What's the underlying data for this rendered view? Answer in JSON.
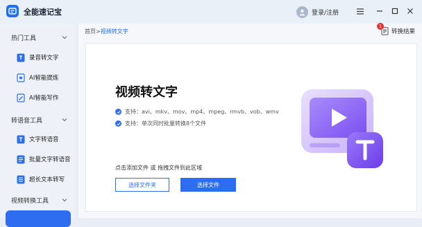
{
  "app": {
    "title": "全能速记宝"
  },
  "user": {
    "login_label": "登录/注册"
  },
  "sidebar": {
    "sections": [
      {
        "title": "热门工具",
        "items": [
          {
            "label": "录音转文字",
            "icon": "audio-file-icon"
          },
          {
            "label": "AI智能提炼",
            "icon": "ai-icon"
          },
          {
            "label": "AI智能写作",
            "icon": "pen-icon"
          }
        ]
      },
      {
        "title": "转语音工具",
        "items": [
          {
            "label": "文字转语音",
            "icon": "text-icon"
          },
          {
            "label": "批量文字转语音",
            "icon": "batch-icon"
          },
          {
            "label": "超长文本转写",
            "icon": "long-text-icon"
          }
        ]
      },
      {
        "title": "视频转换工具",
        "items": []
      }
    ]
  },
  "main": {
    "breadcrumb": {
      "home": "首页",
      "separator": ">",
      "current": "视频转文字"
    },
    "result_button": {
      "label": "转换结果",
      "badge": "1"
    },
    "heading": "视频转文字",
    "support_lines": [
      "支持：avi、mkv、mov、mp4、mpeg、rmvb、vob、wmv",
      "支持：单次同时批量转换8个文件"
    ],
    "hint": "点击添加文件 或 拖拽文件到此区域",
    "buttons": {
      "select_folder": "选择文件夹",
      "select_file": "选择文件"
    }
  },
  "colors": {
    "accent": "#2f6df0",
    "badge": "#e63030",
    "illustration": "#8a63f5"
  }
}
